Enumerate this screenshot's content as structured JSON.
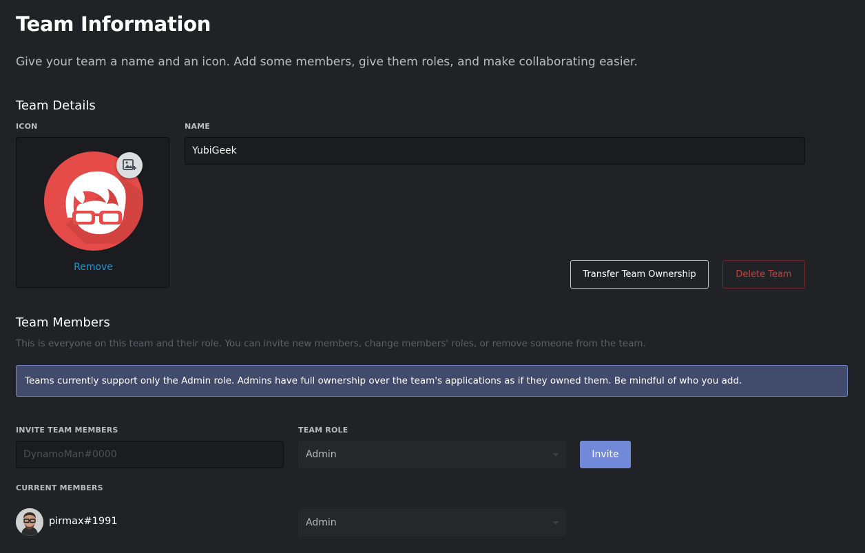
{
  "header": {
    "title": "Team Information",
    "subtitle": "Give your team a name and an icon. Add some members, give them roles, and make collaborating easier."
  },
  "team_details": {
    "section_title": "Team Details",
    "icon_label": "ICON",
    "name_label": "NAME",
    "name_value": "YubiGeek",
    "remove_label": "Remove",
    "upload_icon": "image-add-icon",
    "transfer_button": "Transfer Team Ownership",
    "delete_button": "Delete Team"
  },
  "team_members": {
    "section_title": "Team Members",
    "description": "This is everyone on this team and their role. You can invite new members, change members' roles, or remove someone from the team.",
    "banner": "Teams currently support only the Admin role. Admins have full ownership over the team's applications as if they owned them. Be mindful of who you add.",
    "invite_label": "INVITE TEAM MEMBERS",
    "invite_placeholder": "DynamoMan#0000",
    "role_label": "TEAM ROLE",
    "role_selected": "Admin",
    "invite_button": "Invite",
    "current_label": "CURRENT MEMBERS",
    "members": [
      {
        "name": "pirmax#1991",
        "role": "Admin"
      }
    ]
  },
  "colors": {
    "background": "#202226",
    "accent": "#7289da",
    "danger": "#c6413e",
    "link": "#1e98d6",
    "team_icon": "#e54b48",
    "banner_bg": "#434b6c",
    "banner_border": "#7186c9"
  }
}
